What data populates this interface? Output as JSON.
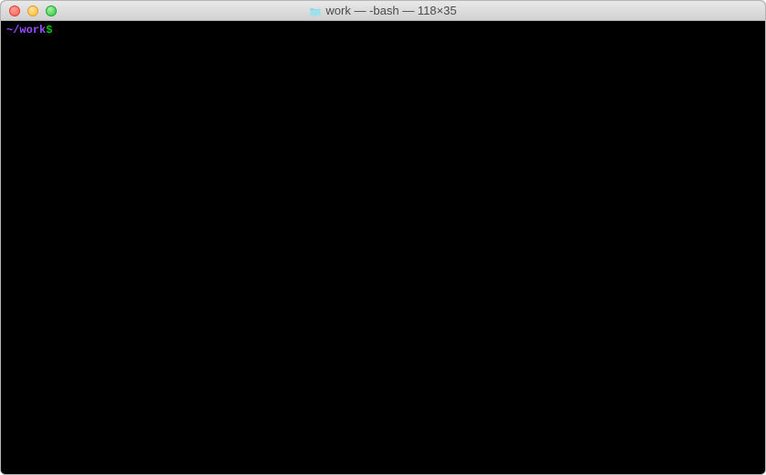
{
  "window": {
    "title": "work — -bash — 118×35"
  },
  "terminal": {
    "prompt_path": "~/work",
    "prompt_symbol": "$",
    "input_value": ""
  }
}
